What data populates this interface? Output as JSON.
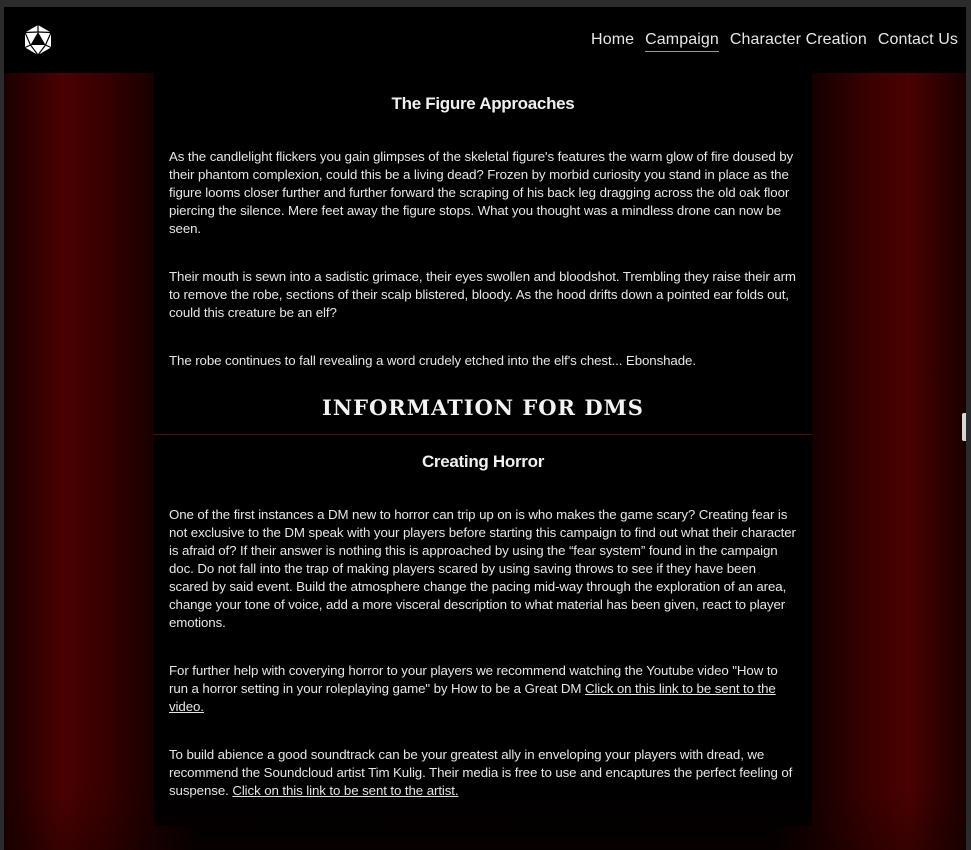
{
  "nav": {
    "logo_icon": "d20-dice-icon",
    "links": [
      "Home",
      "Campaign",
      "Character Creation",
      "Contact Us"
    ],
    "active": "Campaign"
  },
  "story": {
    "title": "The Figure Approaches",
    "paragraphs": [
      "As the candlelight flickers you gain glimpses of the skeletal figure's features the warm glow of fire doused by their phantom complexion, could this be a living dead? Frozen by morbid curiosity you stand in place as the figure looms closer further and further forward the scraping of his back leg dragging across the old oak floor piercing the silence. Mere feet away the figure stops. What you thought was a mindless drone can now be seen.",
      "Their mouth is sewn into a sadistic grimace, their eyes swollen and bloodshot. Trembling they raise their arm to remove the robe, sections of their scalp blistered, bloody. As the hood drifts down a pointed ear folds out, could this creature be an elf?",
      "The robe continues to fall revealing a word crudely etched into the elf's chest... Ebonshade."
    ]
  },
  "dm_info": {
    "heading": "INFORMATION FOR DMS",
    "section_title": "Creating Horror",
    "paragraph1": "One of the first instances a DM new to horror can trip up on is who makes the game scary? Creating fear is not exclusive to the DM speak with your players before starting this campaign to find out what their character is afraid of? If their answer is nothing this is approached by using the “fear system” found in the campaign doc. Do not fall into the trap of making players scared by using saving throws to see if they have been scared by said event. Build the atmosphere change the pacing mid-way through the exploration of an area, change your tone of voice, add a more visceral description to what material has been given, react to player emotions.",
    "paragraph2_text": "For further help with coverying horror to your players we recommend watching the Youtube video \"How to run a horror setting in your roleplaying game\" by How to be a Great DM ",
    "paragraph2_link": "Click on this link to be sent to the video.",
    "paragraph3_text": "To build abience a good soundtrack can be your greatest ally in enveloping your players with dread, we recommend the Soundcloud artist Tim Kulig. Their media is free to use and encaptures the perfect feeling of suspense. ",
    "paragraph3_link": "Click on this link to be sent to the artist."
  },
  "colors": {
    "background_red": "#4a0101",
    "content_bg": "#000000",
    "text": "#e6e6e6"
  }
}
